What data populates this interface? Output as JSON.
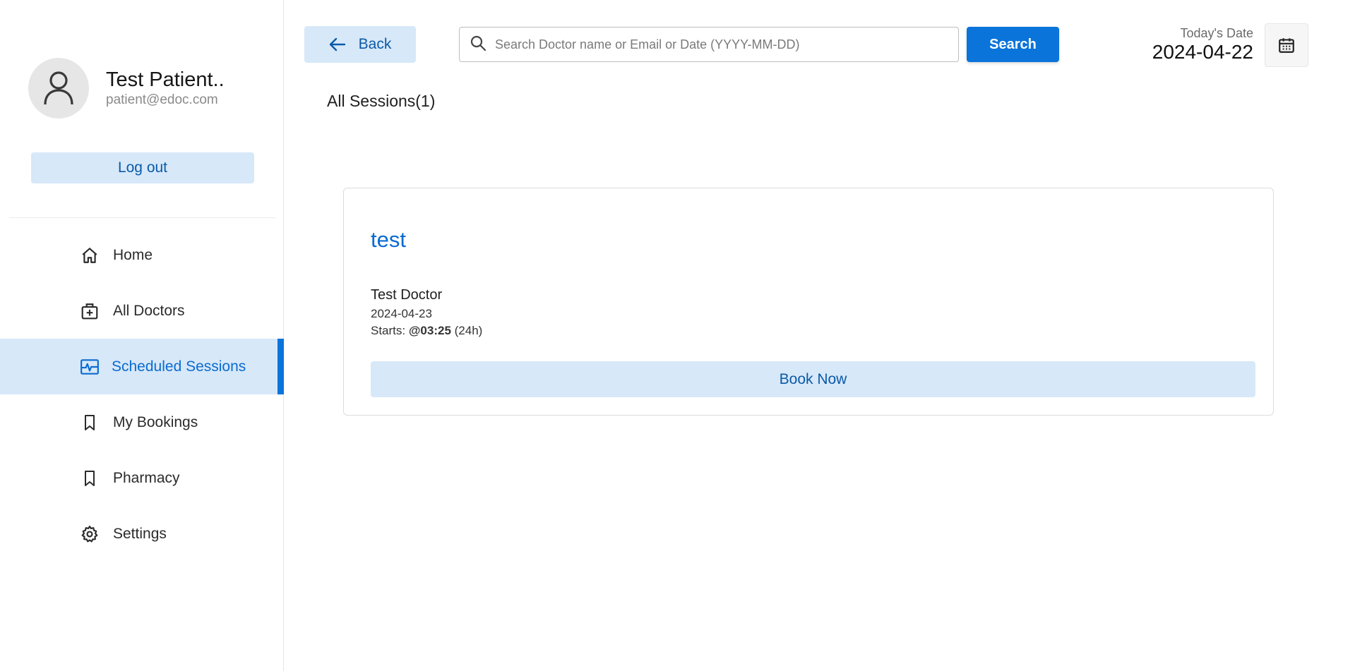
{
  "profile": {
    "name": "Test Patient..",
    "email": "patient@edoc.com"
  },
  "sidebar": {
    "logout_label": "Log out",
    "items": [
      {
        "label": "Home",
        "icon": "home-icon"
      },
      {
        "label": "All Doctors",
        "icon": "medical-bag-icon"
      },
      {
        "label": "Scheduled Sessions",
        "icon": "schedule-icon",
        "active": true
      },
      {
        "label": "My Bookings",
        "icon": "bookmark-icon"
      },
      {
        "label": "Pharmacy",
        "icon": "bookmark-icon"
      },
      {
        "label": "Settings",
        "icon": "gear-icon"
      }
    ]
  },
  "header": {
    "back_label": "Back",
    "search_placeholder": "Search Doctor name or Email or Date (YYYY-MM-DD)",
    "search_value": "",
    "search_button": "Search",
    "date_caption": "Today's Date",
    "date_value": "2024-04-22"
  },
  "main": {
    "section_title": "All Sessions(1)",
    "sessions": [
      {
        "title": "test",
        "doctor": "Test Doctor",
        "date": "2024-04-23",
        "start_prefix": "Starts: ",
        "start_time": "@03:25",
        "start_suffix": " (24h)",
        "book_label": "Book Now"
      }
    ]
  },
  "colors": {
    "accent": "#0a74da",
    "accent_light": "#d7e8f8",
    "accent_text": "#0a5aa8"
  }
}
